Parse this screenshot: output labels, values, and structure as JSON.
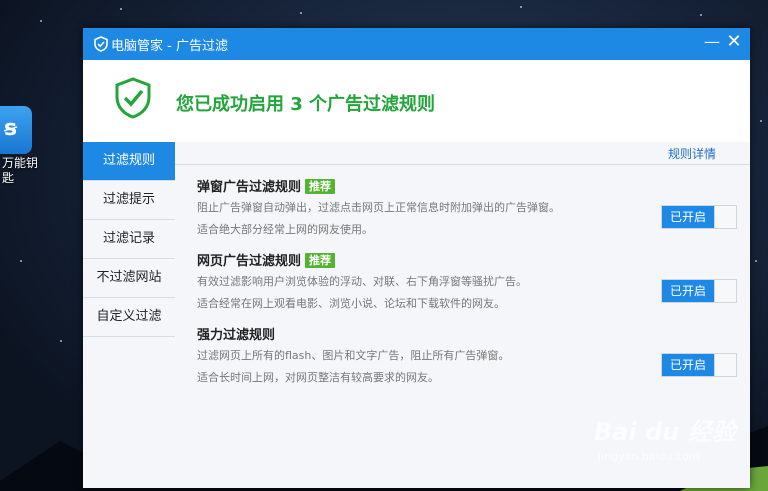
{
  "desktop": {
    "icon_label": "万能钥匙"
  },
  "window": {
    "title": "电脑管家 - 广告过滤",
    "minimize_glyph": "—",
    "close_glyph": "✕"
  },
  "banner": {
    "message": "您已成功启用 3 个广告过滤规则",
    "icon": "shield-check-icon"
  },
  "sidebar": {
    "items": [
      {
        "label": "过滤规则",
        "active": true
      },
      {
        "label": "过滤提示",
        "active": false
      },
      {
        "label": "过滤记录",
        "active": false
      },
      {
        "label": "不过滤网站",
        "active": false
      },
      {
        "label": "自定义过滤",
        "active": false
      }
    ]
  },
  "content": {
    "detail_link": "规则详情",
    "rules": [
      {
        "name": "弹窗广告过滤规则",
        "badge": "推荐",
        "desc1": "阻止广告弹窗自动弹出，过滤点击网页上正常信息时附加弹出的广告弹窗。",
        "desc2": "适合绝大部分经常上网的网友使用。",
        "toggle_label": "已开启",
        "enabled": true
      },
      {
        "name": "网页广告过滤规则",
        "badge": "推荐",
        "desc1": "有效过滤影响用户浏览体验的浮动、对联、右下角浮窗等骚扰广告。",
        "desc2": "适合经常在网上观看电影、浏览小说、论坛和下载软件的网友。",
        "toggle_label": "已开启",
        "enabled": true
      },
      {
        "name": "强力过滤规则",
        "badge": "",
        "desc1": "过滤网页上所有的flash、图片和文字广告，阻止所有广告弹窗。",
        "desc2": "适合长时间上网，对网页整洁有较高要求的网友。",
        "toggle_label": "已开启",
        "enabled": true
      }
    ]
  },
  "watermark": {
    "brand": "Bai du 经验",
    "url": "jingyan.baidu.com"
  },
  "colors": {
    "accent": "#1e88e5",
    "success": "#22a63a",
    "badge": "#53b52f"
  }
}
